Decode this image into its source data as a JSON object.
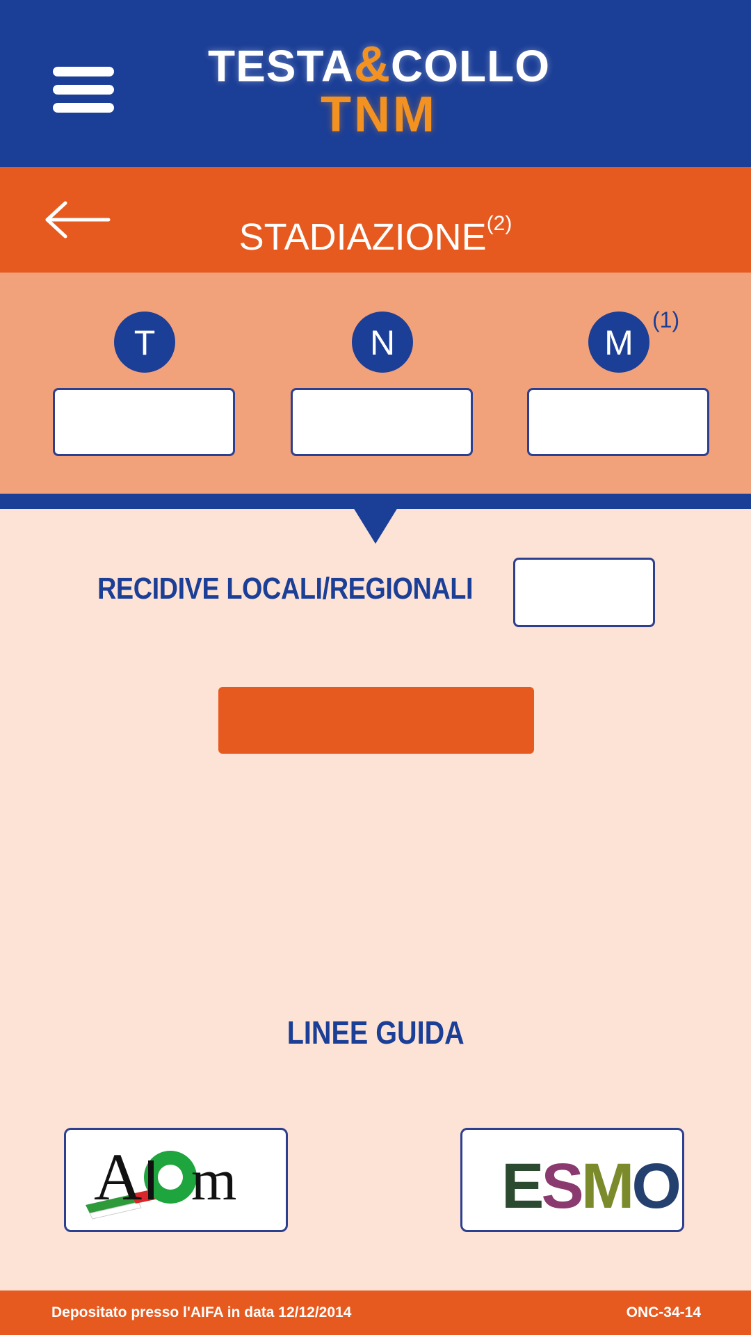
{
  "header": {
    "logo_line1_a": "TESTA",
    "logo_amp": "&",
    "logo_line1_b": "COLLO",
    "logo_line2": "TNM"
  },
  "titlebar": {
    "title": "STADIAZIONE",
    "title_sup": "(2)"
  },
  "tnm": {
    "t": {
      "label": "T",
      "value": ""
    },
    "n": {
      "label": "N",
      "value": ""
    },
    "m": {
      "label": "M",
      "sup": "(1)",
      "value": ""
    }
  },
  "recidive": {
    "label": "RECIDIVE LOCALI/REGIONALI",
    "value": ""
  },
  "calculate_button": {
    "label": ""
  },
  "guidelines": {
    "title": "LINEE GUIDA",
    "aiom_logo_text": "Aiom",
    "esmo_logo_text": "ESMO"
  },
  "footer": {
    "left": "Depositato presso l'AIFA in data 12/12/2014",
    "right": "ONC-34-14"
  },
  "colors": {
    "header_blue": "#1b3e96",
    "accent_orange": "#e65a1f",
    "panel_orange": "#f2a27a",
    "background_peach": "#fce3d6",
    "logo_orange": "#f39220"
  }
}
